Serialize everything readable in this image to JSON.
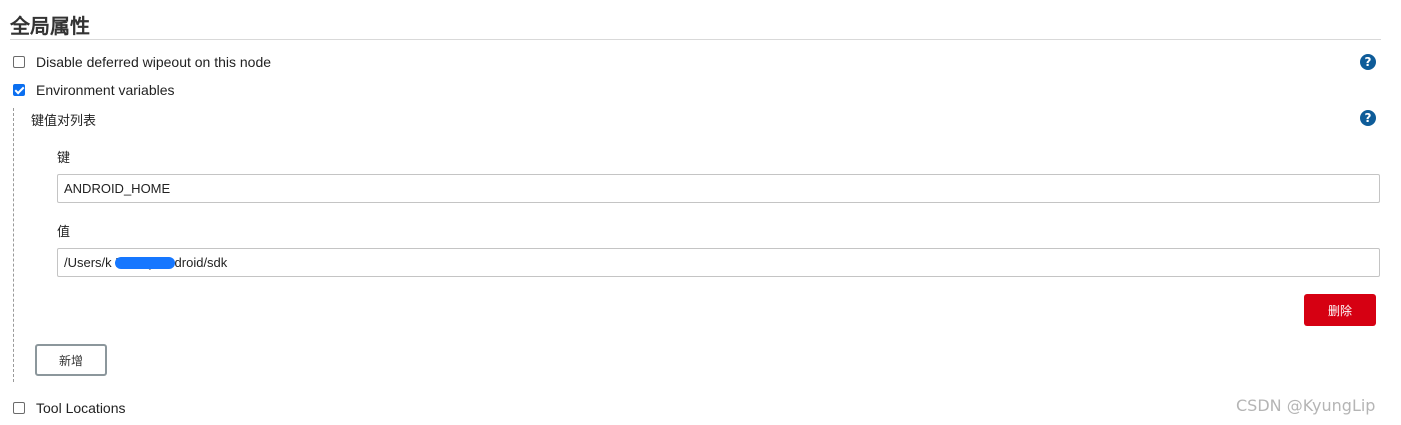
{
  "section": {
    "title": "全局属性"
  },
  "options": {
    "deferred_wipeout": {
      "label": "Disable deferred wipeout on this node",
      "checked": false
    },
    "env_vars": {
      "label": "Environment variables",
      "checked": true
    },
    "tool_locations": {
      "label": "Tool Locations",
      "checked": false
    }
  },
  "kv_list": {
    "label": "键值对列表",
    "key_label": "键",
    "key_value": "ANDROID_HOME",
    "value_label": "值",
    "value_value": "/Users/k          Library/Android/sdk",
    "delete_label": "删除",
    "add_label": "新增"
  },
  "help": {
    "glyph": "?"
  },
  "watermark": "CSDN @KyungLip",
  "colors": {
    "help_icon": "#0e5c99",
    "delete_button": "#d60012",
    "checkbox_checked": "#0b6ff0",
    "redaction": "#1677ff"
  }
}
